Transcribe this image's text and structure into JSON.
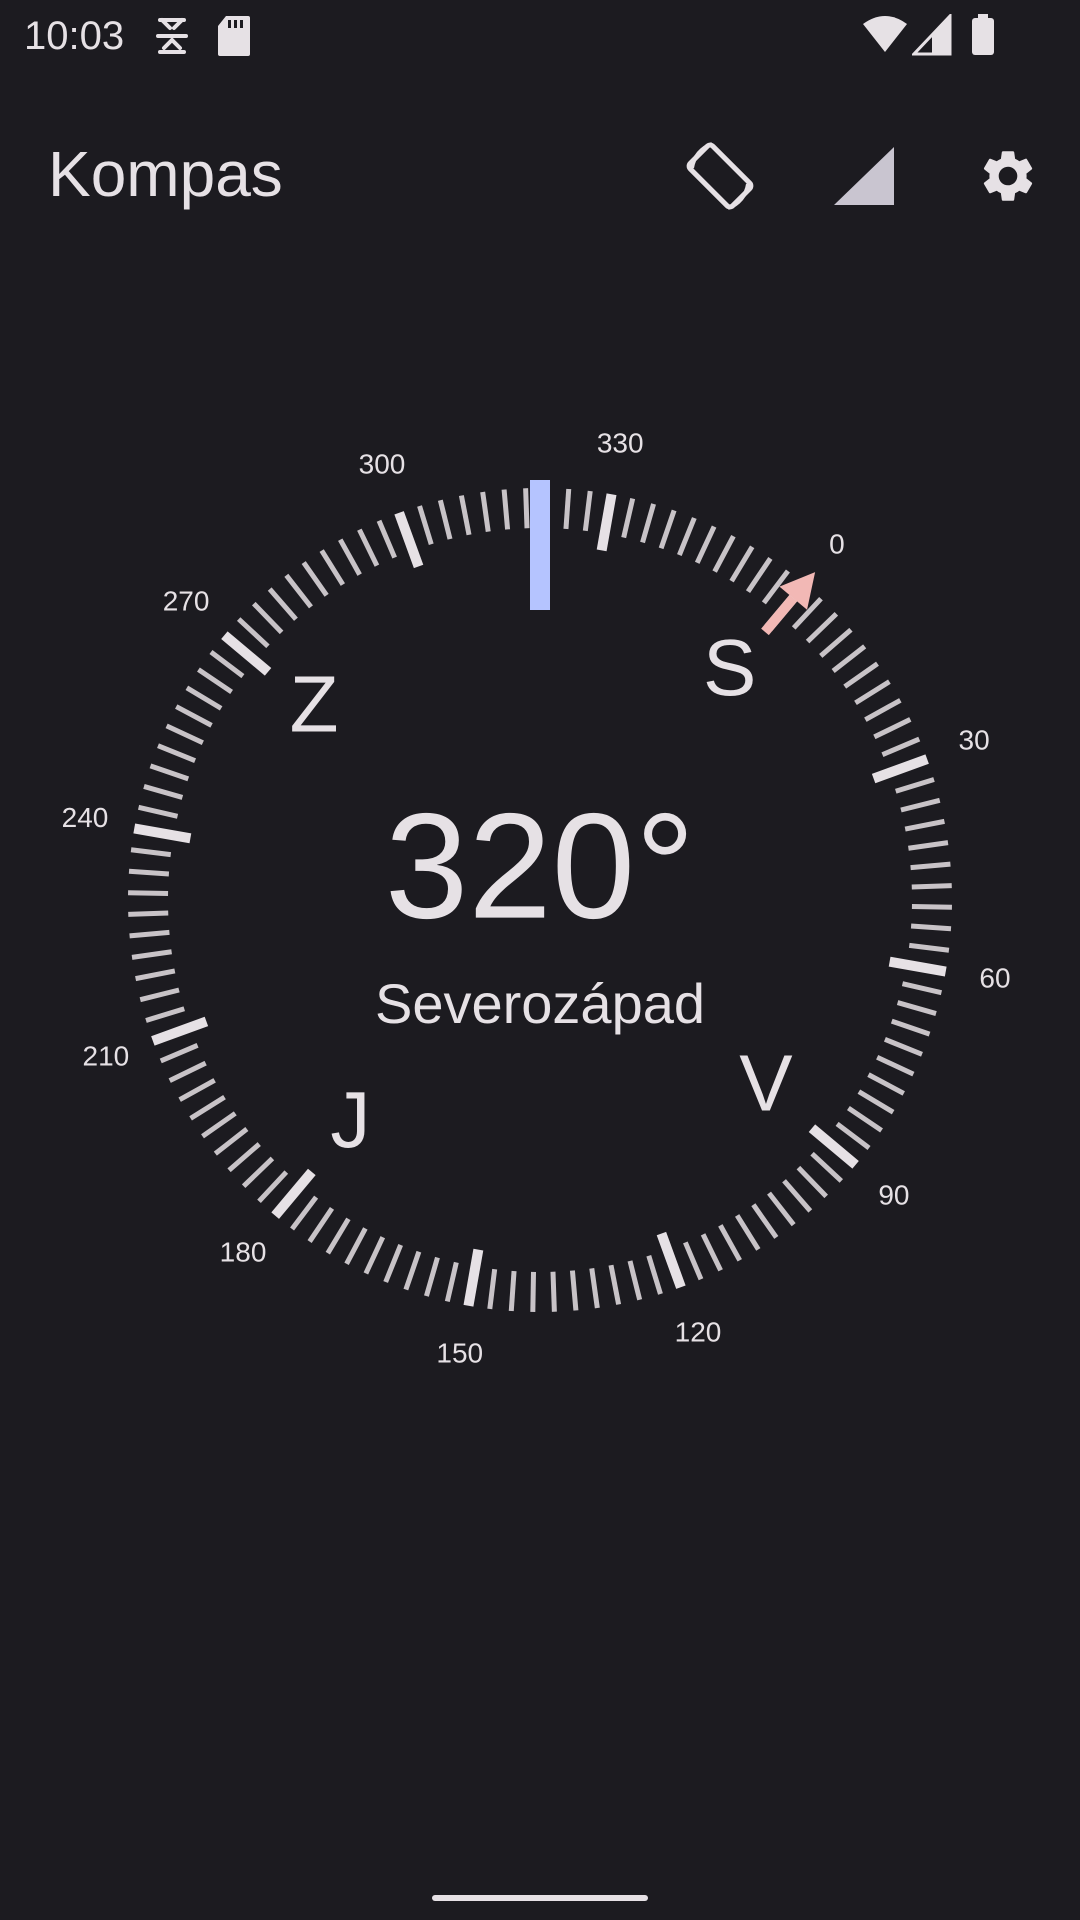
{
  "status_bar": {
    "time": "10:03",
    "left_icons": [
      "debug-icon",
      "sd-card-icon"
    ],
    "right_icons": [
      "wifi-icon",
      "cell-signal-icon",
      "battery-icon"
    ]
  },
  "app_bar": {
    "title": "Kompas",
    "actions": [
      {
        "name": "auto-rotate-icon"
      },
      {
        "name": "signal-triangle-icon"
      },
      {
        "name": "settings-gear-icon"
      }
    ]
  },
  "compass": {
    "heading_value": "320°",
    "heading_degrees": 320,
    "direction_name": "Severozápad",
    "cardinals": [
      {
        "label": "S",
        "bearing": 0
      },
      {
        "label": "V",
        "bearing": 90
      },
      {
        "label": "J",
        "bearing": 180
      },
      {
        "label": "Z",
        "bearing": 270
      }
    ],
    "degree_labels": [
      "0",
      "30",
      "60",
      "90",
      "120",
      "150",
      "180",
      "210",
      "240",
      "270",
      "300",
      "330"
    ],
    "indicator_color": "#b5c4ff",
    "north_arrow_color": "#f2b8b5",
    "tick_color": "#e6e1e5"
  }
}
